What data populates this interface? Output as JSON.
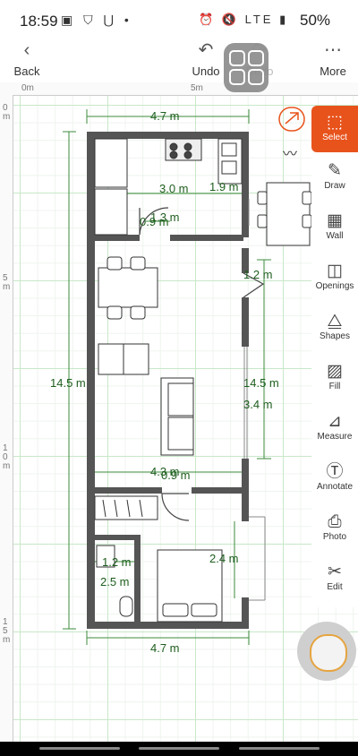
{
  "status": {
    "time": "18:59",
    "left_icons": "▣ ⛉ ⋃ •",
    "right_icons": "⏰ 🔇 LTE ▮",
    "battery": "50%"
  },
  "toolbar": {
    "back_label": "Back",
    "undo_label": "Undo",
    "redo_label": "Redo",
    "more_label": "More"
  },
  "ruler": {
    "top": [
      "0m",
      "5m"
    ],
    "left": [
      "0\nm",
      "5\nm",
      "1\n0\nm",
      "1\n5\nm"
    ]
  },
  "dimensions": {
    "top_width": "4.7 m",
    "bottom_width": "4.7 m",
    "left_height": "14.5 m",
    "right_height": "14.5 m",
    "kitchen_w": "3.0 m",
    "kitchen_small": "1.9 m",
    "kitchen_h": "1.3 m",
    "door_w": "0.9 m",
    "opening_top": "1.2 m",
    "right_mid": "3.4 m",
    "mid_w": "4.3 m",
    "door_w2": "0.9 m",
    "bath_w": "1.2 m",
    "bath_h": "2.5 m",
    "bed_h": "2.4 m"
  },
  "tools": [
    {
      "name": "tool-select",
      "label": "Select",
      "icon": "dashed-select-icon"
    },
    {
      "name": "tool-draw",
      "label": "Draw",
      "icon": "pen-icon"
    },
    {
      "name": "tool-wall",
      "label": "Wall",
      "icon": "brick-icon"
    },
    {
      "name": "tool-openings",
      "label": "Openings",
      "icon": "door-icon"
    },
    {
      "name": "tool-shapes",
      "label": "Shapes",
      "icon": "shapes-icon"
    },
    {
      "name": "tool-fill",
      "label": "Fill",
      "icon": "hatch-icon"
    },
    {
      "name": "tool-measure",
      "label": "Measure",
      "icon": "ruler-icon"
    },
    {
      "name": "tool-annotate",
      "label": "Annotate",
      "icon": "text-icon"
    },
    {
      "name": "tool-photo",
      "label": "Photo",
      "icon": "photo-icon"
    },
    {
      "name": "tool-edit",
      "label": "Edit",
      "icon": "scissors-icon"
    }
  ],
  "colors": {
    "accent": "#e8531c",
    "wall": "#555555",
    "dimension": "#1e5e1e",
    "grid": "#c9e8c9"
  }
}
